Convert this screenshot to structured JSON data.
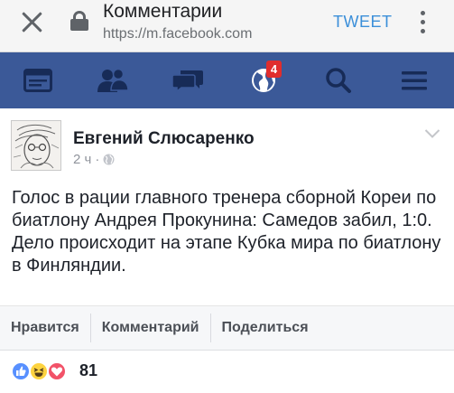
{
  "browser": {
    "title": "Комментарии",
    "url": "https://m.facebook.com",
    "tweet_label": "TWEET",
    "icons": [
      "close-icon",
      "lock-icon",
      "more-vert-icon"
    ]
  },
  "nav": {
    "items": [
      {
        "name": "news-feed-icon"
      },
      {
        "name": "friends-icon"
      },
      {
        "name": "messages-icon"
      },
      {
        "name": "notifications-globe-icon",
        "badge": "4"
      },
      {
        "name": "search-icon"
      },
      {
        "name": "menu-icon"
      }
    ],
    "color": "#3b5998"
  },
  "post": {
    "author": "Евгений Слюсаренко",
    "time": "2 ч",
    "separator": "·",
    "text": "Голос в рации главного тренера сборной Кореи по биатлону Андрея Прокунина: Самедов забил, 1:0. Дело происходит на этапе Кубка мира по биатлону в Финляндии.",
    "actions": {
      "like": "Нравится",
      "comment": "Комментарий",
      "share": "Поделиться"
    }
  },
  "reactions": {
    "types": [
      "like",
      "haha",
      "love"
    ],
    "count": "81"
  }
}
